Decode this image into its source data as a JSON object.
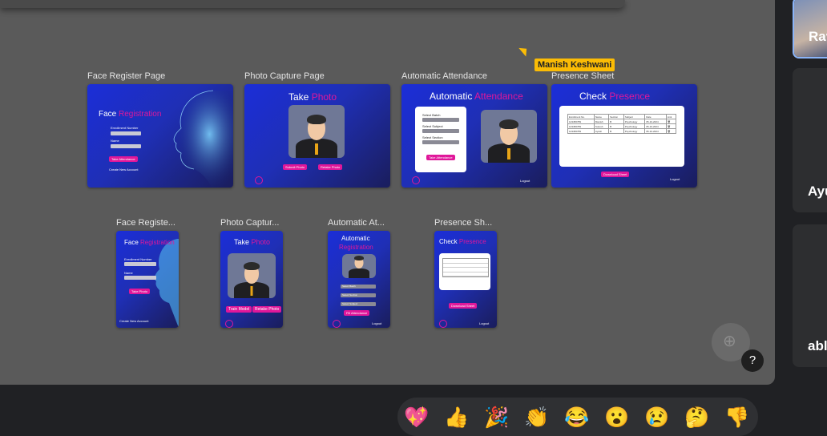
{
  "cursor": {
    "user_name": "Manish Keshwani"
  },
  "frames_row1": [
    {
      "label": "Face Register Page"
    },
    {
      "label": "Photo Capture Page"
    },
    {
      "label": "Automatic Attendance"
    },
    {
      "label": "Presence Sheet"
    }
  ],
  "frames_row2": [
    {
      "label": "Face Registe..."
    },
    {
      "label": "Photo Captur..."
    },
    {
      "label": "Automatic At..."
    },
    {
      "label": "Presence Sh..."
    }
  ],
  "screens": {
    "face_register": {
      "title_a": "Face",
      "title_b": "Registration",
      "enrollment": "Enrollment Number",
      "name": "Name",
      "button": "Take Attendance",
      "footer": "Create New Account"
    },
    "photo_capture": {
      "title_a": "Take",
      "title_b": "Photo",
      "submit": "Submit Photo",
      "retake": "Retake Photo"
    },
    "attendance": {
      "title_a": "Automatic",
      "title_b": "Attendance",
      "batch": "Select Batch",
      "subject": "Select Subject",
      "section": "Select Section",
      "button": "Take Attendance",
      "logout": "Logout"
    },
    "presence": {
      "title_a": "Check",
      "title_b": "Presence",
      "download": "Download Sheet",
      "logout": "Logout",
      "columns": [
        "Enrollment No.",
        "Name",
        "Section",
        "Subject",
        "Date",
        "Link"
      ],
      "rows": [
        [
          "123456789",
          "Manish",
          "B",
          "Psychology",
          "05-10-2024",
          "🗑"
        ],
        [
          "123456789",
          "Suresh",
          "B",
          "Psychology",
          "05-10-2024",
          "🗑"
        ],
        [
          "123456789",
          "Ayush",
          "B",
          "Psychology",
          "05-10-2024",
          "🗑"
        ]
      ]
    },
    "mobile_face": {
      "title_a": "Face",
      "title_b": "Registration",
      "enrollment": "Enrollment Number",
      "name": "Name",
      "button": "Take Photo",
      "footer": "Create New Account"
    },
    "mobile_photo": {
      "title_a": "Take",
      "title_b": "Photo",
      "submit": "Train Model",
      "retake": "Retake Photo"
    },
    "mobile_attendance": {
      "title_a": "Automatic",
      "title_b": "Registration",
      "batch": "Select Batch",
      "section": "Select Section",
      "subject": "Select Subject",
      "button": "Fill Attendance",
      "logout": "Logout"
    },
    "mobile_presence": {
      "title_a": "Check",
      "title_b": "Presence",
      "download": "Download Sheet",
      "logout": "Logout"
    }
  },
  "participants": [
    {
      "name": "Rav"
    },
    {
      "name": "Ayu"
    },
    {
      "name": "abl"
    }
  ],
  "help_label": "?",
  "reactions": [
    "💖",
    "👍",
    "🎉",
    "👏",
    "😂",
    "😮",
    "😢",
    "🤔",
    "👎"
  ],
  "colors": {
    "accent": "#e0179a",
    "cursor": "#fbbc05",
    "frame_blue": "#1f2fb5"
  }
}
